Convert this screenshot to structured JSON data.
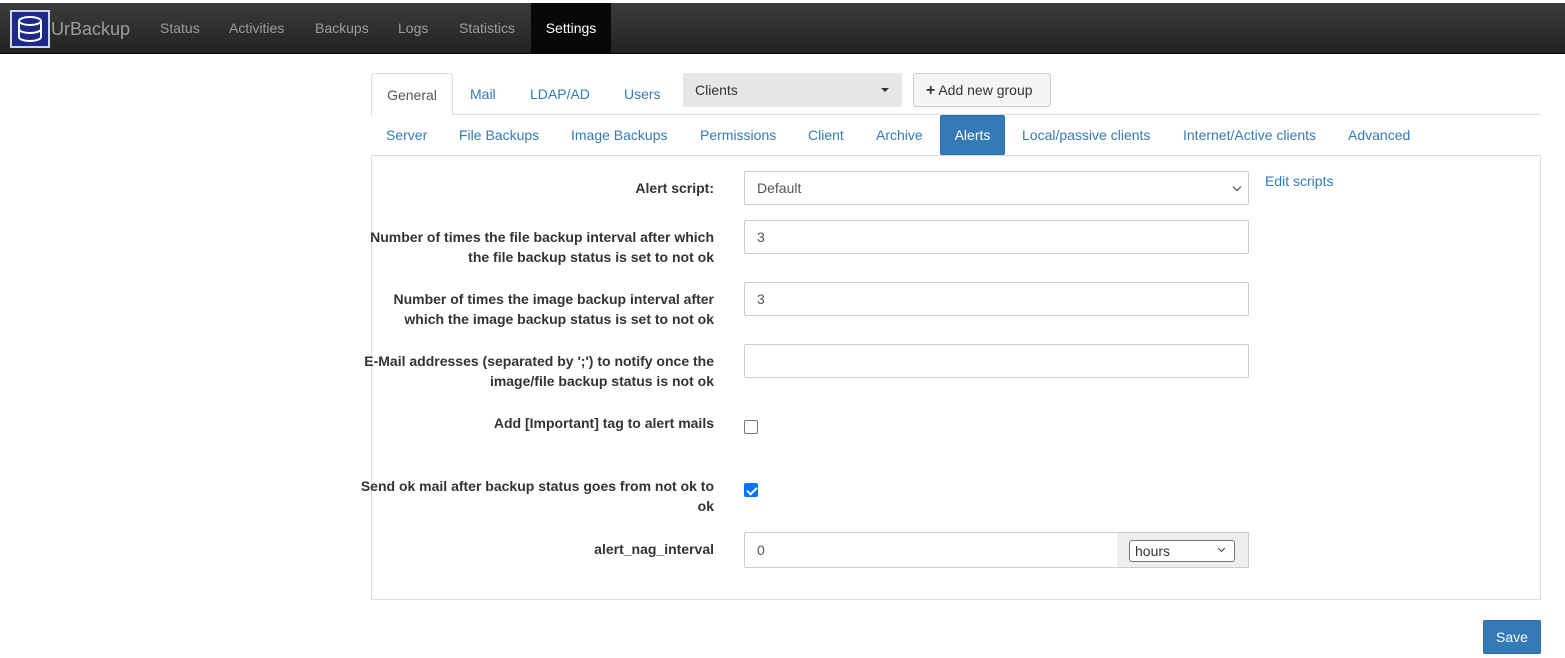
{
  "navbar": {
    "brand": "UrBackup",
    "items": [
      "Status",
      "Activities",
      "Backups",
      "Logs",
      "Statistics",
      "Settings"
    ],
    "active": "Settings"
  },
  "top_tabs": {
    "items": [
      "General",
      "Mail",
      "LDAP/AD",
      "Users"
    ],
    "active": "General",
    "group_select": "Clients",
    "add_group_label": "Add new group"
  },
  "sub_tabs": {
    "items": [
      "Server",
      "File Backups",
      "Image Backups",
      "Permissions",
      "Client",
      "Archive",
      "Alerts",
      "Local/passive clients",
      "Internet/Active clients",
      "Advanced"
    ],
    "active": "Alerts"
  },
  "form": {
    "alert_script_label": "Alert script:",
    "alert_script_value": "Default",
    "edit_scripts_link": "Edit scripts",
    "file_interval_label": "Number of times the file backup interval after which the file backup status is set to not ok",
    "file_interval_value": "3",
    "image_interval_label": "Number of times the image backup interval after which the image backup status is set to not ok",
    "image_interval_value": "3",
    "email_label": "E-Mail addresses (separated by ';') to notify once the image/file backup status is not ok",
    "email_value": "",
    "important_tag_label": "Add [Important] tag to alert mails",
    "important_tag_checked": false,
    "ok_mail_label": "Send ok mail after backup status goes from not ok to ok",
    "ok_mail_checked": true,
    "nag_label": "alert_nag_interval",
    "nag_value": "0",
    "nag_unit": "hours"
  },
  "save_label": "Save",
  "colors": {
    "accent": "#337ab7",
    "navbar": "#222222",
    "checkbox": "#0075ff"
  }
}
